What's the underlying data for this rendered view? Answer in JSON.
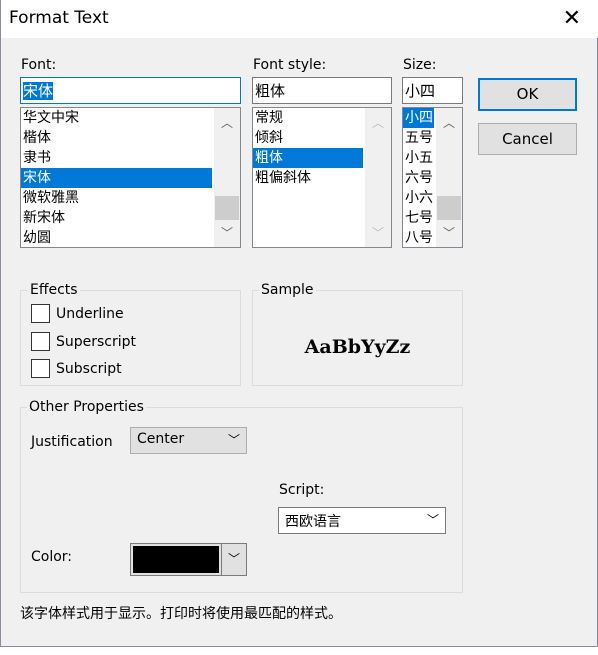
{
  "window": {
    "title": "Format Text"
  },
  "font": {
    "label": "Font:",
    "value": "宋体",
    "items": [
      "华文中宋",
      "楷体",
      "隶书",
      "宋体",
      "微软雅黑",
      "新宋体",
      "幼圆"
    ],
    "selected_index": 3
  },
  "font_style": {
    "label": "Font style:",
    "value": "粗体",
    "items": [
      "常规",
      "倾斜",
      "粗体",
      "粗偏斜体"
    ],
    "selected_index": 2
  },
  "size": {
    "label": "Size:",
    "value": "小四",
    "items": [
      "小四",
      "五号",
      "小五",
      "六号",
      "小六",
      "七号",
      "八号"
    ],
    "selected_index": 0
  },
  "buttons": {
    "ok": "OK",
    "cancel": "Cancel"
  },
  "effects": {
    "title": "Effects",
    "underline": "Underline",
    "superscript": "Superscript",
    "subscript": "Subscript",
    "underline_checked": false,
    "superscript_checked": false,
    "subscript_checked": false
  },
  "sample": {
    "title": "Sample",
    "text": "AaBbYyZz"
  },
  "other": {
    "title": "Other Properties",
    "justification_label": "Justification",
    "justification_value": "Center",
    "script_label": "Script:",
    "script_value": "西欧语言",
    "color_label": "Color:",
    "color_value": "#000000"
  },
  "footer": {
    "note": "该字体样式用于显示。打印时将使用最匹配的样式。"
  },
  "colors": {
    "accent": "#0078d7",
    "dialog_bg": "#f0f0f0"
  }
}
